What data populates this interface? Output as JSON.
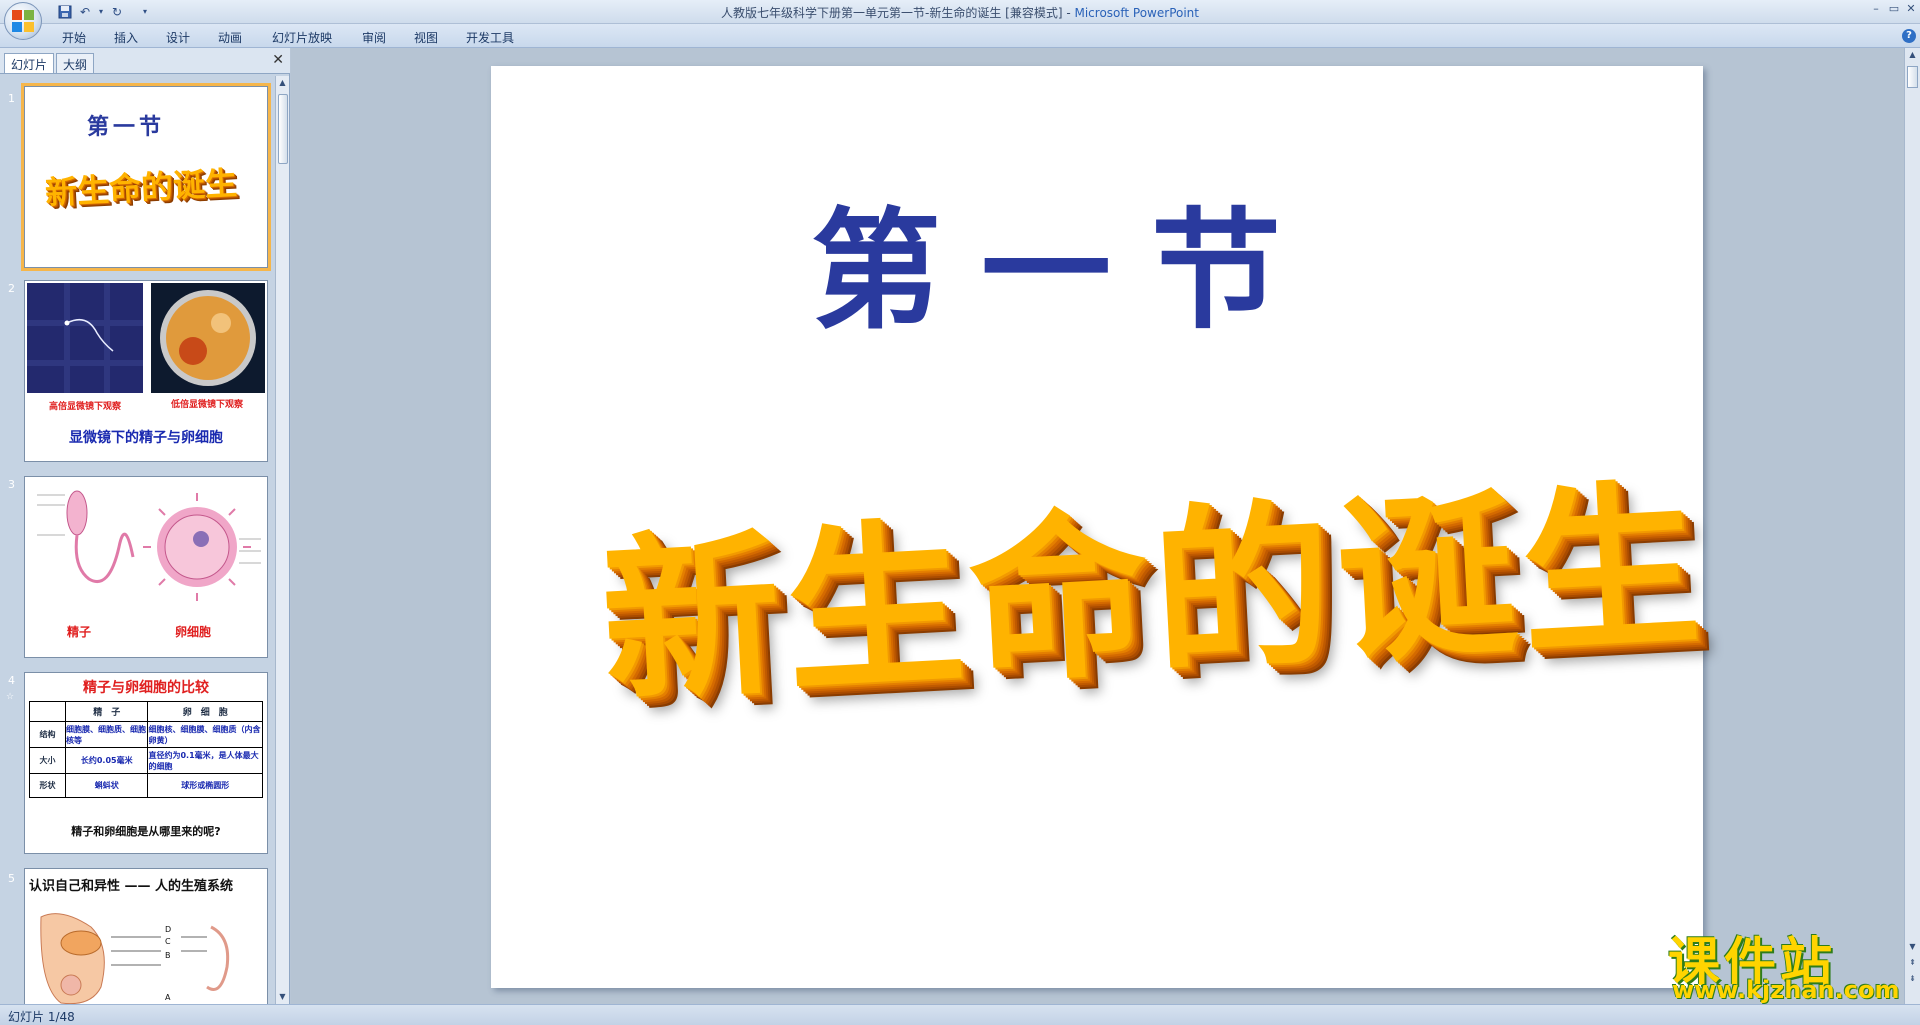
{
  "window": {
    "title": "人教版七年级科学下册第一单元第一节-新生命的诞生 [兼容模式]",
    "app_name": "Microsoft PowerPoint",
    "separator": " - "
  },
  "ribbon": {
    "tabs": [
      "开始",
      "插入",
      "设计",
      "动画",
      "幻灯片放映",
      "审阅",
      "视图",
      "开发工具"
    ]
  },
  "panel": {
    "tabs": [
      "幻灯片",
      "大纲"
    ],
    "close": "✕"
  },
  "thumbnails": [
    {
      "num": "1",
      "title": "第一节",
      "subtitle": "新生命的诞生"
    },
    {
      "num": "2",
      "left_caption": "高倍显微镜下观察",
      "right_caption": "低倍显微镜下观察",
      "title": "显微镜下的精子与卵细胞"
    },
    {
      "num": "3",
      "left_caption": "精子",
      "right_caption": "卵细胞"
    },
    {
      "num": "4",
      "title": "精子与卵细胞的比较",
      "table": {
        "headers": [
          "",
          "精　子",
          "卵　细　胞"
        ],
        "rows": [
          [
            "结构",
            "细胞膜、细胞质、细胞核等",
            "细胞核、细胞膜、细胞质（内含卵黄）"
          ],
          [
            "大小",
            "长约0.05毫米",
            "直径约为0.1毫米，是人体最大的细胞"
          ],
          [
            "形状",
            "蝌蚪状",
            "球形或椭圆形"
          ]
        ]
      },
      "footer": "精子和卵细胞是从哪里来的呢?"
    },
    {
      "num": "5",
      "title": "认识自己和异性 —— 人的生殖系统",
      "labels": [
        "D",
        "C",
        "B",
        "A"
      ]
    }
  ],
  "slide": {
    "title": "第一节",
    "subtitle": "新生命的诞生"
  },
  "watermark": {
    "cn": "课件站",
    "url": "www.kjzhan.com"
  },
  "status": {
    "text": "幻灯片 1/48"
  },
  "colors": {
    "title_blue": "#2a3a9e",
    "subtitle_orange": "#ffb300",
    "selected_outline": "#f6b64b"
  }
}
